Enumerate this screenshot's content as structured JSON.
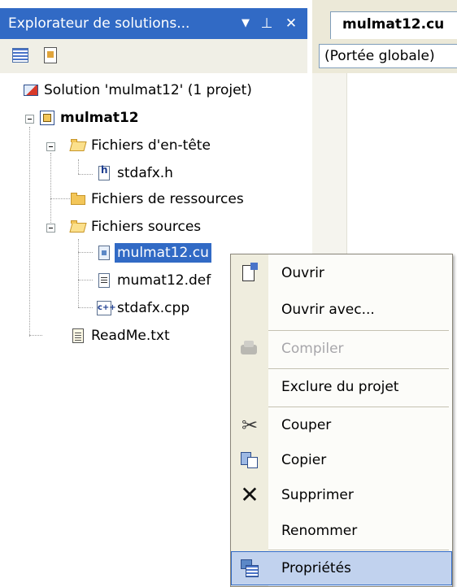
{
  "panel": {
    "title": "Explorateur de solutions...",
    "dropdown_glyph": "▼",
    "pin_glyph": "⊥",
    "close_glyph": "✕",
    "toolbar_icons": [
      "properties-icon",
      "show-all-files-icon"
    ]
  },
  "tree": {
    "solution": "Solution 'mulmat12' (1 projet)",
    "project": "mulmat12",
    "header_folder": "Fichiers d'en-tête",
    "header_file": "stdafx.h",
    "resource_folder": "Fichiers de ressources",
    "source_folder": "Fichiers sources",
    "source_files": [
      "mulmat12.cu",
      "mumat12.def",
      "stdafx.cpp"
    ],
    "readme": "ReadMe.txt",
    "selected": "mulmat12.cu"
  },
  "editor": {
    "tab": "mulmat12.cu",
    "scope": "(Portée globale)"
  },
  "context_menu": {
    "items": [
      {
        "label": "Ouvrir",
        "icon": "open-icon",
        "enabled": true
      },
      {
        "label": "Ouvrir avec...",
        "icon": "",
        "enabled": true
      },
      {
        "label": "Compiler",
        "icon": "compile-icon",
        "enabled": false
      },
      {
        "label": "Exclure du projet",
        "icon": "",
        "enabled": true
      },
      {
        "label": "Couper",
        "icon": "scissors-icon",
        "enabled": true
      },
      {
        "label": "Copier",
        "icon": "copy-icon",
        "enabled": true
      },
      {
        "label": "Supprimer",
        "icon": "delete-icon",
        "enabled": true
      },
      {
        "label": "Renommer",
        "icon": "",
        "enabled": true
      },
      {
        "label": "Propriétés",
        "icon": "properties-icon",
        "enabled": true,
        "highlighted": true
      }
    ]
  },
  "colors": {
    "selection": "#316ac5",
    "menu_hover": "#c1d2ee",
    "toolbar_bg": "#f0efe6"
  }
}
